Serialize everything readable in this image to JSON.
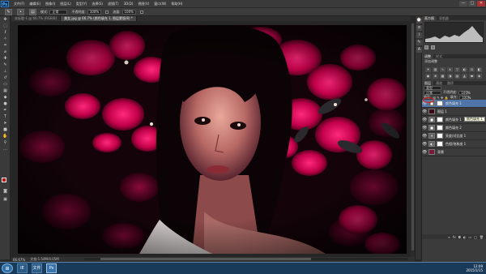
{
  "menubar": {
    "logo": "Ps",
    "items": [
      "文件(F)",
      "编辑(E)",
      "图像(I)",
      "图层(L)",
      "类型(Y)",
      "选择(S)",
      "滤镜(T)",
      "3D(D)",
      "视图(V)",
      "窗口(W)",
      "帮助(H)"
    ],
    "window_buttons": [
      "—",
      "□",
      "✕"
    ]
  },
  "options": {
    "mode_label": "模式:",
    "mode_value": "正常",
    "opacity_label": "不透明度:",
    "opacity_value": "100%",
    "flow_label": "流量:",
    "flow_value": "100%"
  },
  "doc_tabs": [
    {
      "label": "未标题-1 @ 66.7% (RGB/8)"
    },
    {
      "label": "美女.jpg @ 66.7% (颜色填充 1, 图层蒙版/8) *"
    }
  ],
  "status": {
    "zoom": "66.67%",
    "doc": "文档:1.54M/4.05M"
  },
  "panels": {
    "histogram_tabs": [
      "直方图",
      "导航器"
    ],
    "adjust_tabs": [
      "调整",
      "样式"
    ],
    "adjust_label": "添加调整",
    "layers_tabs": [
      "图层",
      "通道",
      "路径"
    ],
    "kind_label": "类型",
    "blend_mode": "正常",
    "opacity_label": "不透明度:",
    "opacity_value": "100%",
    "lock_label": "锁定:",
    "fill_label": "填充:",
    "fill_value": "100%",
    "layers": [
      {
        "name": "颜色填充 1",
        "selected": true,
        "thumb": "adj"
      },
      {
        "name": "图层 1",
        "selected": false,
        "thumb": "dark"
      },
      {
        "name": "颜色填充 1",
        "selected": false,
        "thumb": "adj"
      },
      {
        "name": "颜色填充 2",
        "selected": false,
        "thumb": "adj"
      },
      {
        "name": "亮度/对比度 1",
        "selected": false,
        "thumb": "adj"
      },
      {
        "name": "色相/饱和度 1",
        "selected": false,
        "thumb": "adj"
      },
      {
        "name": "背景",
        "selected": false,
        "thumb": "photo"
      }
    ],
    "tooltip": "颜色填充 1"
  },
  "taskbar": {
    "time": "12:09",
    "date": "2015/1/15",
    "apps": [
      "IE",
      "文件夹",
      "Ps"
    ]
  },
  "colors": {
    "accent_selected": "#4e74a8",
    "annotation_red": "#e21c1c",
    "foreground_swatch": "#c01010"
  }
}
